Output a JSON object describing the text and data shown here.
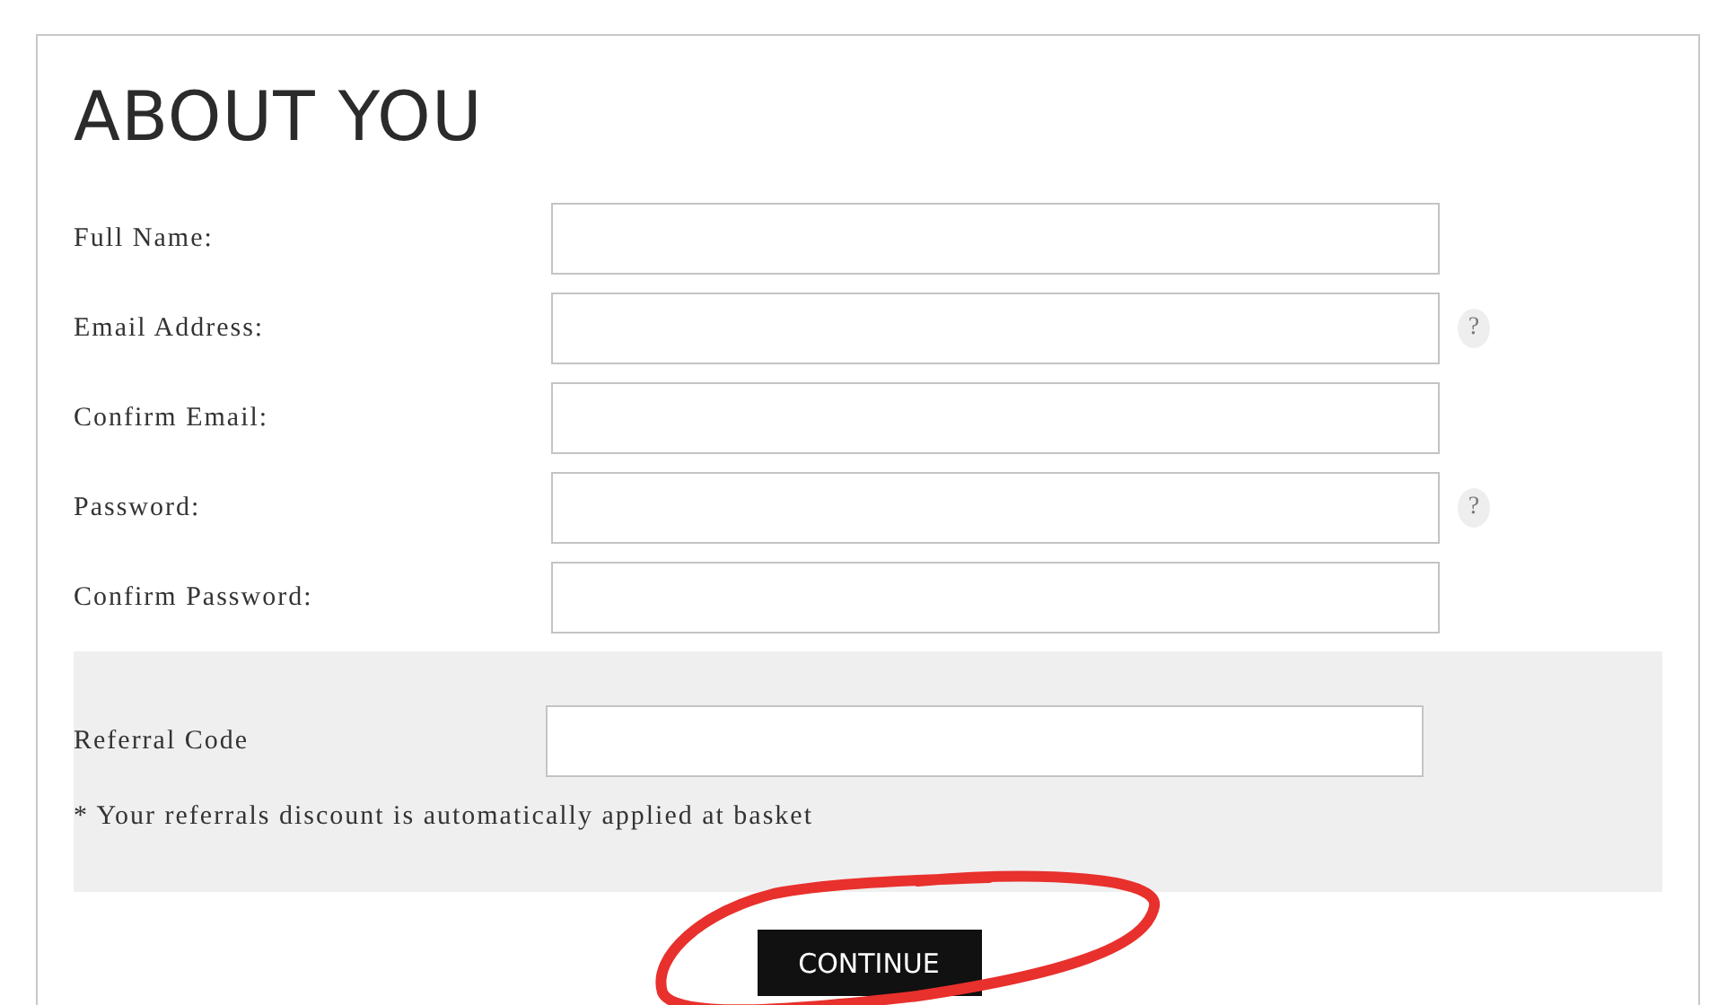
{
  "title": "ABOUT YOU",
  "fields": [
    {
      "label": "Full Name:",
      "help": false
    },
    {
      "label": "Email Address:",
      "help": true,
      "help_text": "?"
    },
    {
      "label": "Confirm Email:",
      "help": false
    },
    {
      "label": "Password:",
      "help": true,
      "help_text": "?"
    },
    {
      "label": "Confirm Password:",
      "help": false
    }
  ],
  "referral": {
    "label": "Referral Code",
    "note": "* Your referrals discount is automatically applied at basket"
  },
  "button": "CONTINUE",
  "annotation": {
    "kind": "ellipse"
  }
}
